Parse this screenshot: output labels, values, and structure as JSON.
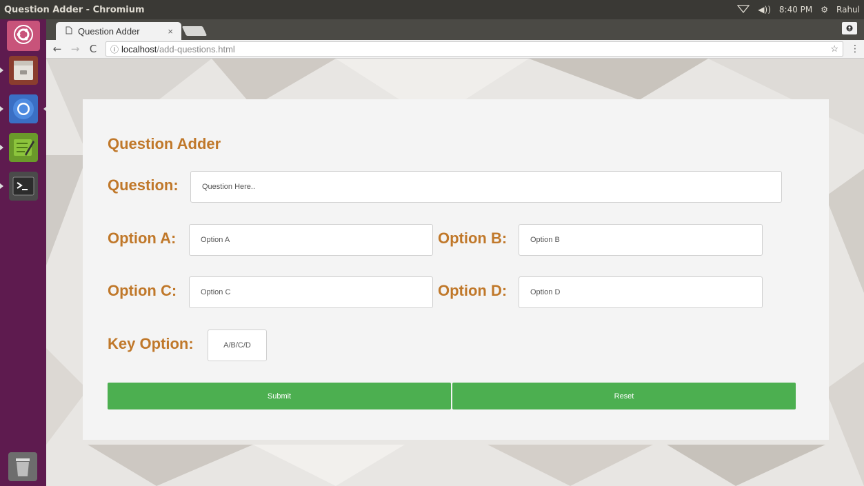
{
  "system": {
    "window_title": "Question Adder - Chromium",
    "clock": "8:40 PM",
    "user": "Rahul"
  },
  "launcher": {
    "items": [
      "ubuntu-dash",
      "files",
      "chromium",
      "text-editor",
      "terminal",
      "trash"
    ]
  },
  "browser": {
    "tab_title": "Question Adder",
    "tab_close": "×",
    "url_host": "localhost",
    "url_path": "/add-questions.html",
    "info_icon": "ⓘ"
  },
  "form": {
    "title": "Question Adder",
    "question_label": "Question:",
    "question_placeholder": "Question Here..",
    "option_a_label": "Option A:",
    "option_a_placeholder": "Option A",
    "option_b_label": "Option B:",
    "option_b_placeholder": "Option B",
    "option_c_label": "Option C:",
    "option_c_placeholder": "Option C",
    "option_d_label": "Option D:",
    "option_d_placeholder": "Option D",
    "key_label": "Key Option:",
    "key_placeholder": "A/B/C/D",
    "submit_label": "Submit",
    "reset_label": "Reset"
  },
  "colors": {
    "label": "#c0782a",
    "button": "#4caf50",
    "launcher": "#5e1b4f"
  }
}
